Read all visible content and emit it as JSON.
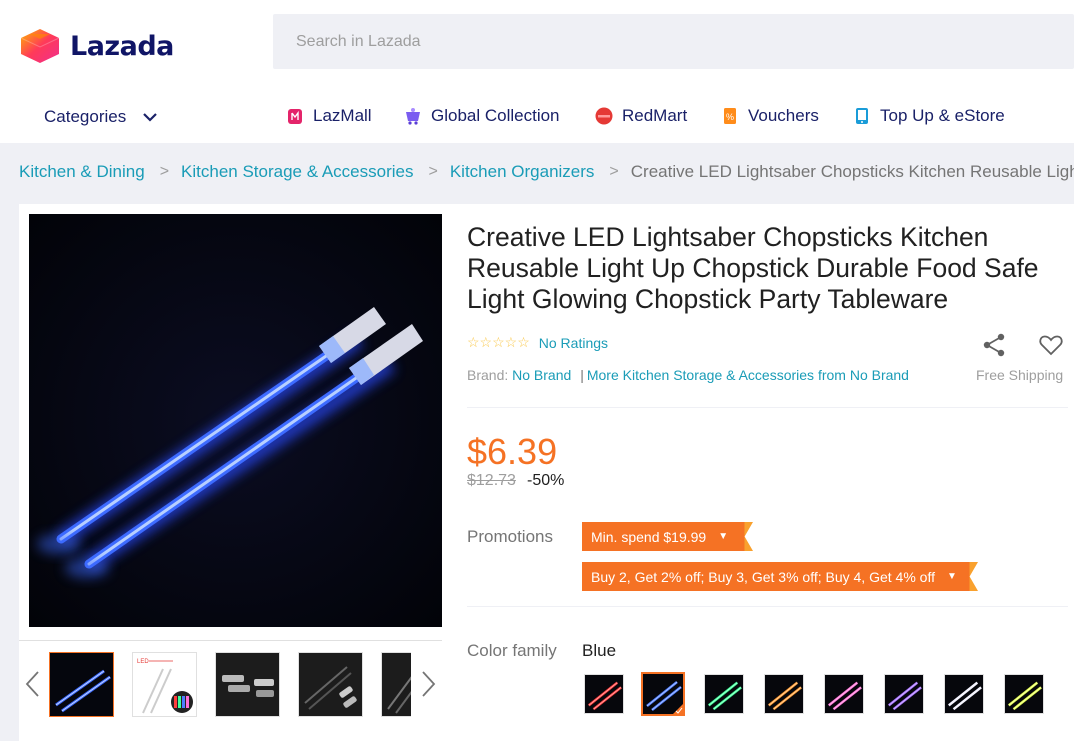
{
  "header": {
    "logo_text": "Lazada",
    "search_placeholder": "Search in Lazada"
  },
  "nav": {
    "categories_label": "Categories",
    "items": [
      {
        "label": "LazMall",
        "icon": "lazmall-icon"
      },
      {
        "label": "Global Collection",
        "icon": "global-collection-icon"
      },
      {
        "label": "RedMart",
        "icon": "redmart-icon"
      },
      {
        "label": "Vouchers",
        "icon": "voucher-icon"
      },
      {
        "label": "Top Up & eStore",
        "icon": "topup-icon"
      }
    ]
  },
  "breadcrumb": {
    "items": [
      "Kitchen & Dining",
      "Kitchen Storage & Accessories",
      "Kitchen Organizers"
    ],
    "current": "Creative LED Lightsaber Chopsticks Kitchen Reusable Light Up Chopstick Durable Food Safe Light Glowing Chopstick Party Tableware"
  },
  "product": {
    "title": "Creative LED Lightsaber Chopsticks Kitchen Reusable Light Up Chopstick Durable Food Safe Light Glowing Chopstick Party Tableware",
    "ratings_text": "No Ratings",
    "rating_stars": 0,
    "brand_label": "Brand:",
    "brand_value": "No Brand",
    "more_from": "More Kitchen Storage & Accessories from No Brand",
    "shipping": "Free Shipping",
    "price": "$6.39",
    "original_price": "$12.73",
    "discount": "-50%",
    "promotions_label": "Promotions",
    "promotions": [
      "Min. spend $19.99",
      "Buy 2, Get 2% off; Buy 3, Get 3% off; Buy 4, Get 4% off"
    ],
    "color_label": "Color family",
    "color_selected": "Blue",
    "color_swatches": [
      "red",
      "blue",
      "green",
      "orange",
      "pink",
      "purple",
      "white",
      "yellow"
    ],
    "swatch_colors": [
      "#ff3b3b",
      "#4d7dff",
      "#3dff9a",
      "#ff9a2e",
      "#ff6fd8",
      "#a36bff",
      "#f2f2ff",
      "#e6ff4d"
    ],
    "selected_swatch_index": 1
  },
  "colors": {
    "accent": "#f57224",
    "link": "#1a9cb7",
    "nav_text": "#1a2168"
  }
}
